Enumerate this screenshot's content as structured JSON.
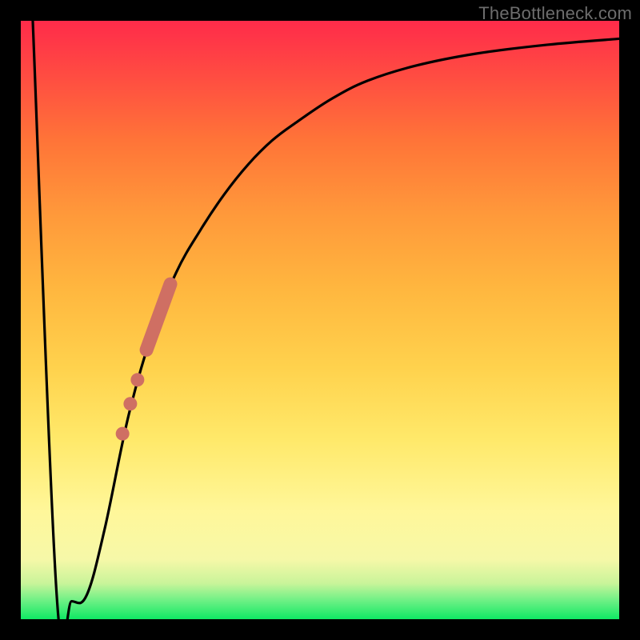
{
  "watermark": "TheBottleneck.com",
  "colors": {
    "curve_stroke": "#000000",
    "marker_fill": "#cf6f63",
    "marker_stroke": "#cf6f63"
  },
  "chart_data": {
    "type": "line",
    "title": "",
    "xlabel": "",
    "ylabel": "",
    "xlim": [
      0,
      100
    ],
    "ylim": [
      0,
      100
    ],
    "grid": false,
    "series": [
      {
        "name": "curve",
        "x": [
          2,
          6,
          8.5,
          11,
          14,
          18,
          22,
          26,
          30,
          34,
          38,
          42,
          46,
          52,
          58,
          66,
          76,
          88,
          100
        ],
        "y": [
          100,
          4,
          3,
          4,
          15,
          34,
          48,
          58,
          65,
          71,
          76,
          80,
          83,
          87,
          90,
          92.5,
          94.5,
          96,
          97
        ]
      }
    ],
    "markers": {
      "thick_segment": {
        "x_start": 21,
        "y_start": 45,
        "x_end": 25,
        "y_end": 56
      },
      "dots": [
        {
          "x": 19.5,
          "y": 40
        },
        {
          "x": 18.3,
          "y": 36
        },
        {
          "x": 17.0,
          "y": 31
        }
      ]
    }
  }
}
